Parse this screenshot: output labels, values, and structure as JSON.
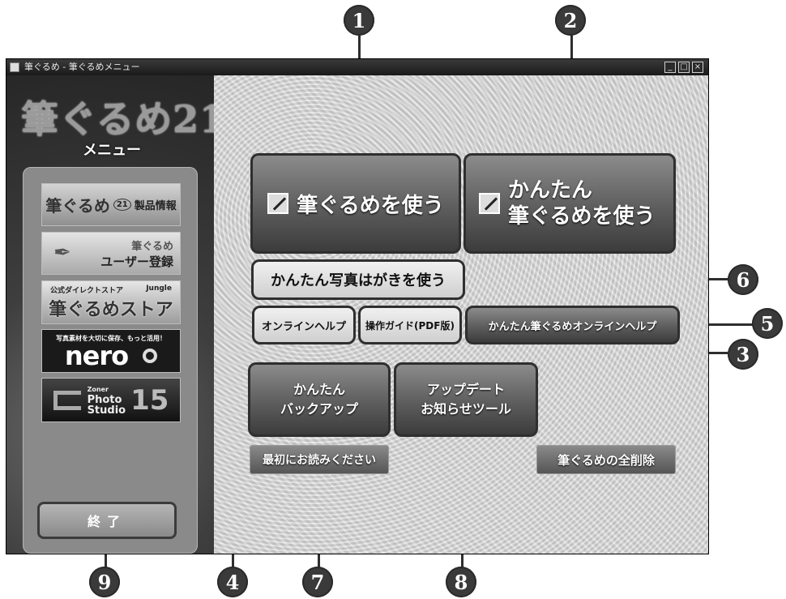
{
  "window": {
    "title": "筆ぐるめ - 筆ぐるめメニュー",
    "controls": {
      "minimize": "_",
      "maximize": "□",
      "close": "×"
    }
  },
  "logo": {
    "main": "筆ぐるめ21",
    "sub": "メニュー"
  },
  "banners": {
    "product_info": {
      "title": "筆ぐるめ",
      "num": "21",
      "label": "製品情報"
    },
    "user_register": {
      "line1": "筆ぐるめ",
      "line2": "ユーザー登録"
    },
    "store": {
      "top": "公式ダイレクトストア",
      "tag": "Jungle",
      "main": "筆ぐるめストア"
    },
    "nero": {
      "top": "写真素材を大切に保存、もっと活用！",
      "main": "nero"
    },
    "zoner": {
      "line1": "Zoner",
      "line2": "Photo",
      "line3": "Studio",
      "num": "15"
    }
  },
  "buttons": {
    "use_fudegurume": "筆ぐるめを使う",
    "easy_line1": "かんたん",
    "easy_line2": "筆ぐるめを使う",
    "photo_postcard": "かんたん写真はがきを使う",
    "online_help": "オンラインヘルプ",
    "pdf_guide": "操作ガイド(PDF版)",
    "easy_online_help": "かんたん筆ぐるめオンラインヘルプ",
    "backup_line1": "かんたん",
    "backup_line2": "バックアップ",
    "update_line1": "アップデート",
    "update_line2": "お知らせツール",
    "readme": "最初にお読みください",
    "uninstall": "筆ぐるめの全削除",
    "exit": "終了"
  },
  "callouts": [
    "1",
    "2",
    "3",
    "4",
    "5",
    "6",
    "7",
    "8",
    "9"
  ]
}
